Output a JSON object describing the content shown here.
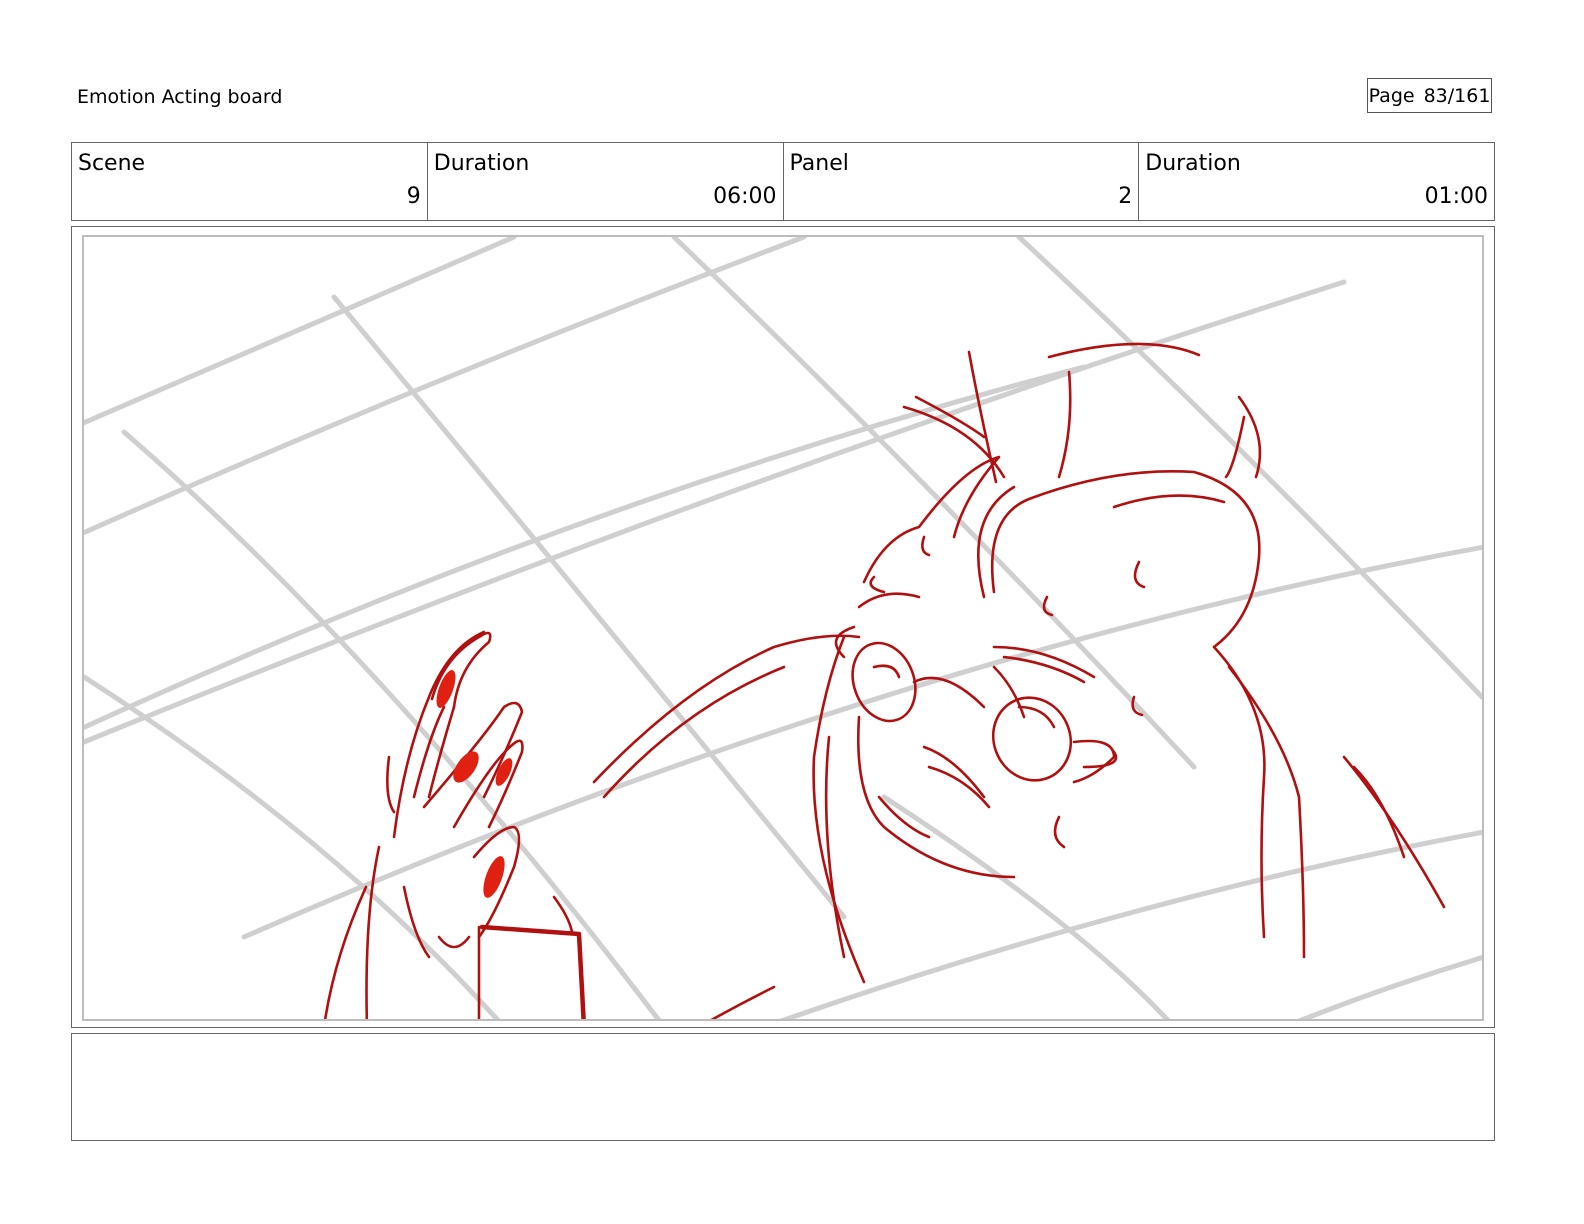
{
  "document": {
    "title": "Emotion Acting board",
    "page_label": "Page",
    "page_number": "83/161"
  },
  "info": [
    {
      "label": "Scene",
      "value": "9"
    },
    {
      "label": "Duration",
      "value": "06:00"
    },
    {
      "label": "Panel",
      "value": "2"
    },
    {
      "label": "Duration",
      "value": "01:00"
    }
  ],
  "panel": {
    "sketch_color": "#b01010",
    "nail_color": "#e02010",
    "grid_color": "#cfcfcf"
  },
  "notes": ""
}
